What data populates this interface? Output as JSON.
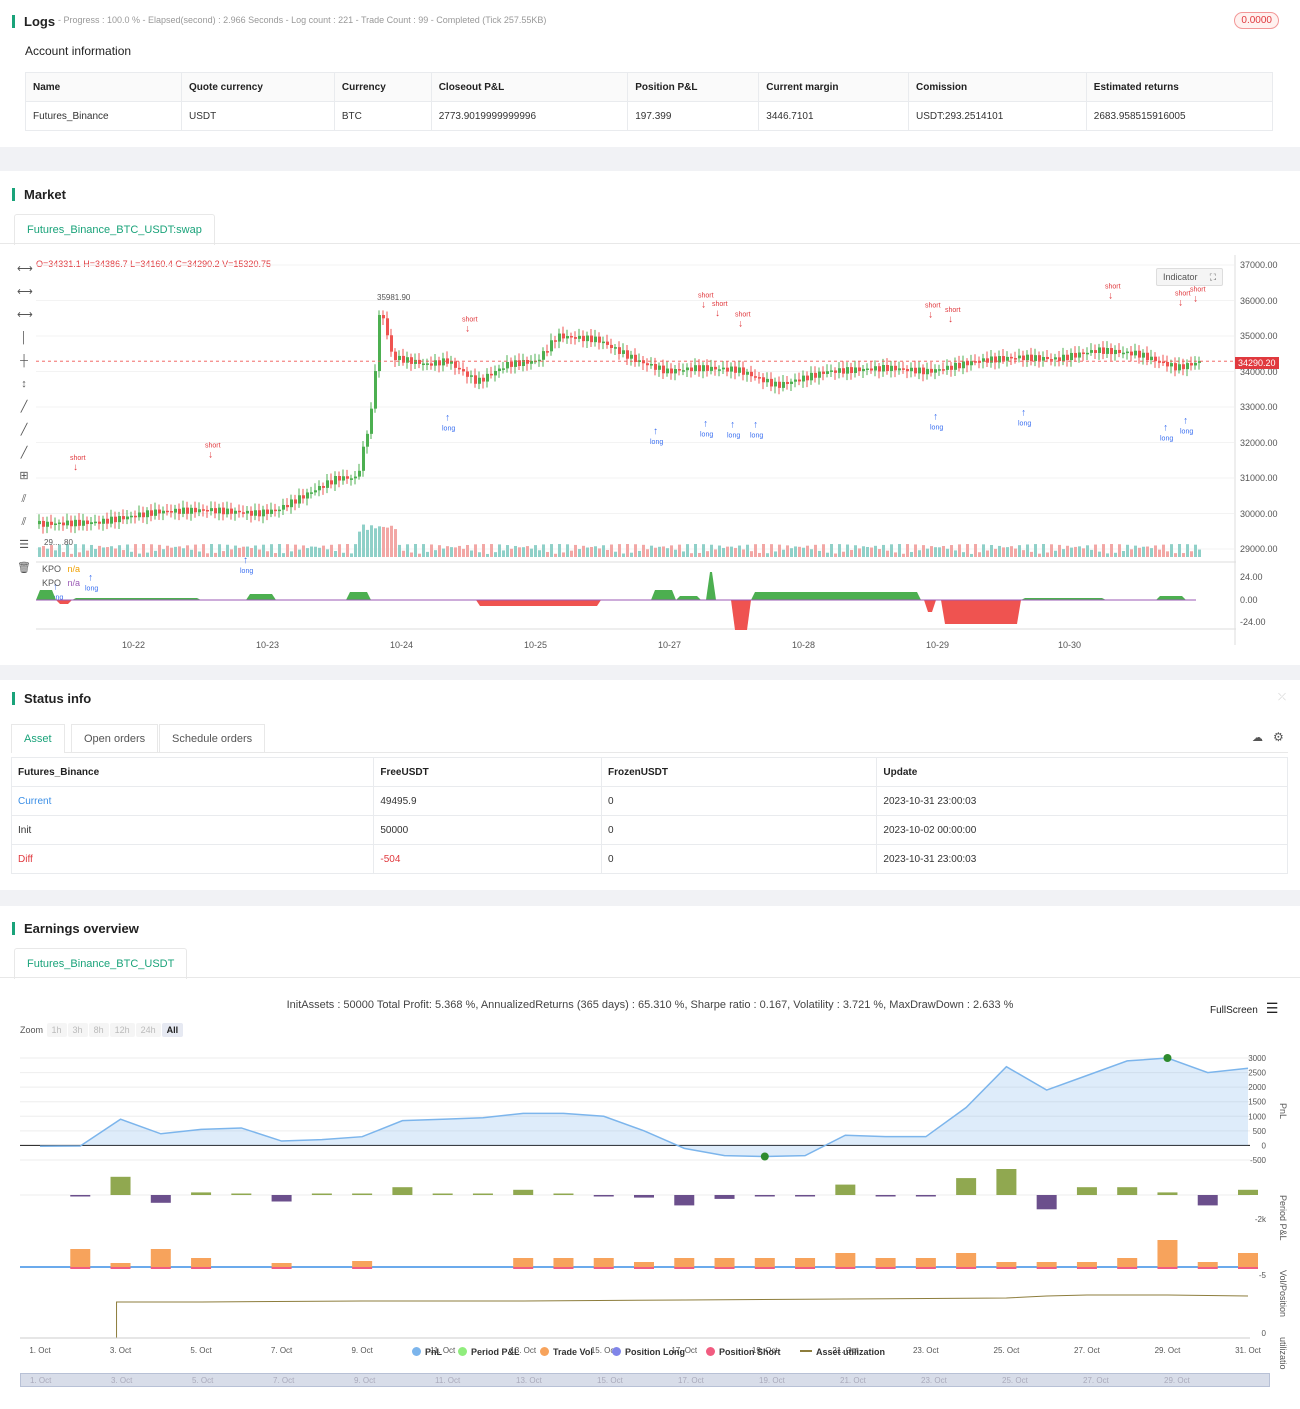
{
  "logs": {
    "title": "Logs",
    "meta": "- Progress : 100.0 % - Elapsed(second) : 2.966  Seconds - Log count : 221 - Trade Count : 99 - Completed (Tick 257.55KB)",
    "badge": "0.0000"
  },
  "account": {
    "title": "Account information",
    "headers": [
      "Name",
      "Quote currency",
      "Currency",
      "Closeout P&L",
      "Position P&L",
      "Current margin",
      "Comission",
      "Estimated returns"
    ],
    "row": [
      "Futures_Binance",
      "USDT",
      "BTC",
      "2773.9019999999996",
      "197.399",
      "3446.7101",
      "USDT:293.2514101",
      "2683.958515916005"
    ]
  },
  "market": {
    "title": "Market",
    "tab": "Futures_Binance_BTC_USDT:swap",
    "ohlc": "O=34331.1 H=34386.7 L=34160.4 C=34290.2 V=15320.75",
    "indicator_btn": "Indicator",
    "last_price": "34290.20",
    "peak_label": "35981.90",
    "low_label": "29... .80",
    "kpo": {
      "name": "KPO",
      "v1": "n/a",
      "v2": "n/a"
    },
    "price_ticks": [
      "37000.00",
      "36000.00",
      "35000.00",
      "34000.00",
      "33000.00",
      "32000.00",
      "31000.00",
      "30000.00",
      "29000.00"
    ],
    "kpo_ticks": [
      "24.00",
      "0.00",
      "-24.00"
    ],
    "date_ticks": [
      "10-22",
      "10-23",
      "10-24",
      "10-25",
      "10-27",
      "10-28",
      "10-29",
      "10-30"
    ],
    "colors": {
      "up": "#4caf50",
      "down": "#ef5350",
      "signal_short": "#e0393e",
      "signal_long": "#3a6ff0",
      "close": "#c03ad8"
    }
  },
  "status": {
    "title": "Status info",
    "tabs": [
      "Asset",
      "Open orders",
      "Schedule orders"
    ],
    "headers": [
      "Futures_Binance",
      "FreeUSDT",
      "FrozenUSDT",
      "Update"
    ],
    "rows": [
      [
        "Current",
        "49495.9",
        "0",
        "2023-10-31 23:00:03"
      ],
      [
        "Init",
        "50000",
        "0",
        "2023-10-02 00:00:00"
      ],
      [
        "Diff",
        "-504",
        "0",
        "2023-10-31 23:00:03"
      ]
    ]
  },
  "earnings": {
    "title": "Earnings overview",
    "tab": "Futures_Binance_BTC_USDT",
    "summary": "InitAssets : 50000 Total Profit: 5.368 %, AnnualizedReturns (365 days) : 65.310 %, Sharpe ratio : 0.167, Volatility : 3.721 %, MaxDrawDown : 2.633 %",
    "fullscreen": "FullScreen",
    "zoom_label": "Zoom",
    "zoom_buttons": [
      "1h",
      "3h",
      "8h",
      "12h",
      "24h",
      "All"
    ],
    "pnl_ticks": [
      "3000",
      "2500",
      "2000",
      "1500",
      "1000",
      "500",
      "0",
      "-500"
    ],
    "axis_titles": [
      "PnL",
      "Period P&L",
      "Vol/Position",
      "utilization"
    ],
    "period_tick": "-2k",
    "vol_tick": "-5",
    "util_tick": "0",
    "x_ticks": [
      "1. Oct",
      "3. Oct",
      "5. Oct",
      "7. Oct",
      "9. Oct",
      "11. Oct",
      "13. Oct",
      "15. Oct",
      "17. Oct",
      "19. Oct",
      "21. Oct",
      "23. Oct",
      "25. Oct",
      "27. Oct",
      "29. Oct",
      "31. Oct"
    ],
    "legend": [
      {
        "label": "PnL",
        "color": "#7cb5ec"
      },
      {
        "label": "Period P&L",
        "color": "#90ed7d"
      },
      {
        "label": "Trade Vol",
        "color": "#f7a35c"
      },
      {
        "label": "Position Long",
        "color": "#8085e9"
      },
      {
        "label": "Position Short",
        "color": "#f15c80"
      },
      {
        "label": "Asset utilization",
        "color": "#8d7d3c"
      }
    ],
    "chart_data": {
      "type": "line",
      "x": [
        "1. Oct",
        "2. Oct",
        "3. Oct",
        "4. Oct",
        "5. Oct",
        "6. Oct",
        "7. Oct",
        "8. Oct",
        "9. Oct",
        "10. Oct",
        "11. Oct",
        "12. Oct",
        "13. Oct",
        "14. Oct",
        "15. Oct",
        "16. Oct",
        "17. Oct",
        "18. Oct",
        "19. Oct",
        "20. Oct",
        "21. Oct",
        "22. Oct",
        "23. Oct",
        "24. Oct",
        "25. Oct",
        "26. Oct",
        "27. Oct",
        "28. Oct",
        "29. Oct",
        "30. Oct",
        "31. Oct"
      ],
      "series": [
        {
          "name": "PnL",
          "values": [
            -30,
            -20,
            900,
            400,
            550,
            600,
            150,
            200,
            300,
            850,
            900,
            950,
            1100,
            1100,
            1000,
            500,
            -100,
            -350,
            -380,
            -350,
            350,
            300,
            300,
            1300,
            2700,
            1900,
            2400,
            2900,
            3000,
            2500,
            2650
          ]
        }
      ],
      "ylim": [
        -600,
        3200
      ]
    }
  }
}
